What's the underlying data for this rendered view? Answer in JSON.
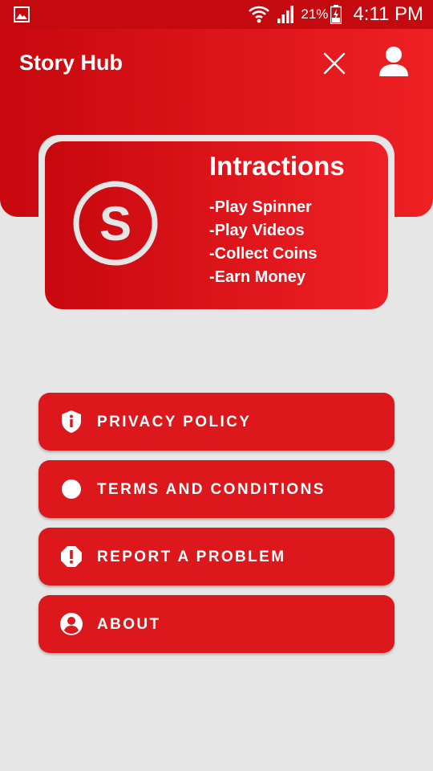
{
  "status_bar": {
    "battery_percent": "21%",
    "time": "4:11 PM",
    "icons": [
      "gallery-icon",
      "wifi-icon",
      "signal-icon",
      "battery-charging-icon"
    ]
  },
  "header": {
    "title": "Story Hub",
    "close_icon": "close-icon",
    "profile_icon": "person-icon"
  },
  "card": {
    "logo_letter": "S",
    "title": "Intractions",
    "features": [
      "-Play Spinner",
      "-Play Videos",
      "-Collect Coins",
      "-Earn Money"
    ]
  },
  "menu": {
    "items": [
      {
        "label": "PRIVACY POLICY",
        "icon": "shield-info-icon"
      },
      {
        "label": "TERMS AND CONDITIONS",
        "icon": "circle-icon"
      },
      {
        "label": "REPORT A PROBLEM",
        "icon": "alert-octagon-icon"
      },
      {
        "label": "ABOUT",
        "icon": "account-circle-icon"
      }
    ]
  },
  "colors": {
    "primary": "#dc181c",
    "gradient_start": "#c7080e",
    "gradient_end": "#ef2025",
    "background": "#e6e6e6",
    "text": "#ffffff"
  }
}
